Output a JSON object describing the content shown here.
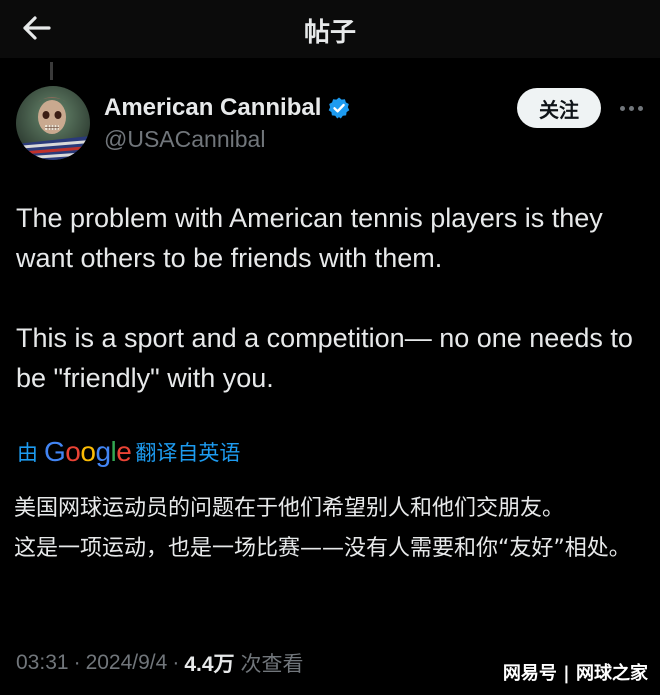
{
  "header": {
    "title": "帖子",
    "back_icon": "arrow-left-icon"
  },
  "author": {
    "display_name": "American Cannibal",
    "handle": "@USACannibal",
    "verified": true,
    "verified_color": "#1d9bf0",
    "follow_label": "关注",
    "more_icon": "more-horizontal-icon"
  },
  "tweet": {
    "paragraphs": [
      "The problem with American tennis players is they want others to be friends with them.",
      "This is a sport and a competition— no one needs to be \"friendly\" with you."
    ]
  },
  "translation": {
    "prefix": "由",
    "brand": "Google",
    "suffix": "翻译自英语",
    "paragraphs": [
      "美国网球运动员的问题在于他们希望别人和他们交朋友。",
      "这是一项运动，也是一场比赛——没有人需要和你“友好”相处。"
    ]
  },
  "meta": {
    "time": "03:31",
    "separator": "·",
    "date": "2024/9/4",
    "views_count": "4.4万",
    "views_label": "次查看"
  },
  "watermark": "网易号 | 网球之家",
  "colors": {
    "background": "#000000",
    "text_primary": "#e7e9ea",
    "text_secondary": "#71767b",
    "link": "#1d9bf0",
    "follow_bg": "#eff3f4"
  }
}
